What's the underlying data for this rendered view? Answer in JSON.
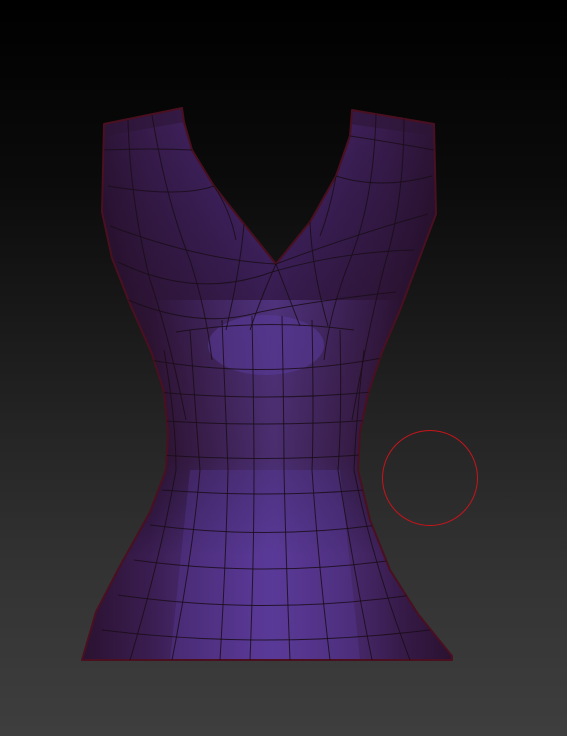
{
  "app": {
    "view": "3d-viewport",
    "background": {
      "top": "#000000",
      "bottom": "#3e3e3e"
    }
  },
  "model": {
    "object": "sleeveless-top-mesh",
    "display": "polyframe",
    "colors": {
      "highlight": "#5a3a9a",
      "mid": "#3f2363",
      "shadow": "#2a1230",
      "edge": "#1a0d17",
      "rim": "#4a1020"
    }
  },
  "brush": {
    "shape": "circle",
    "color": "#c8141b"
  }
}
